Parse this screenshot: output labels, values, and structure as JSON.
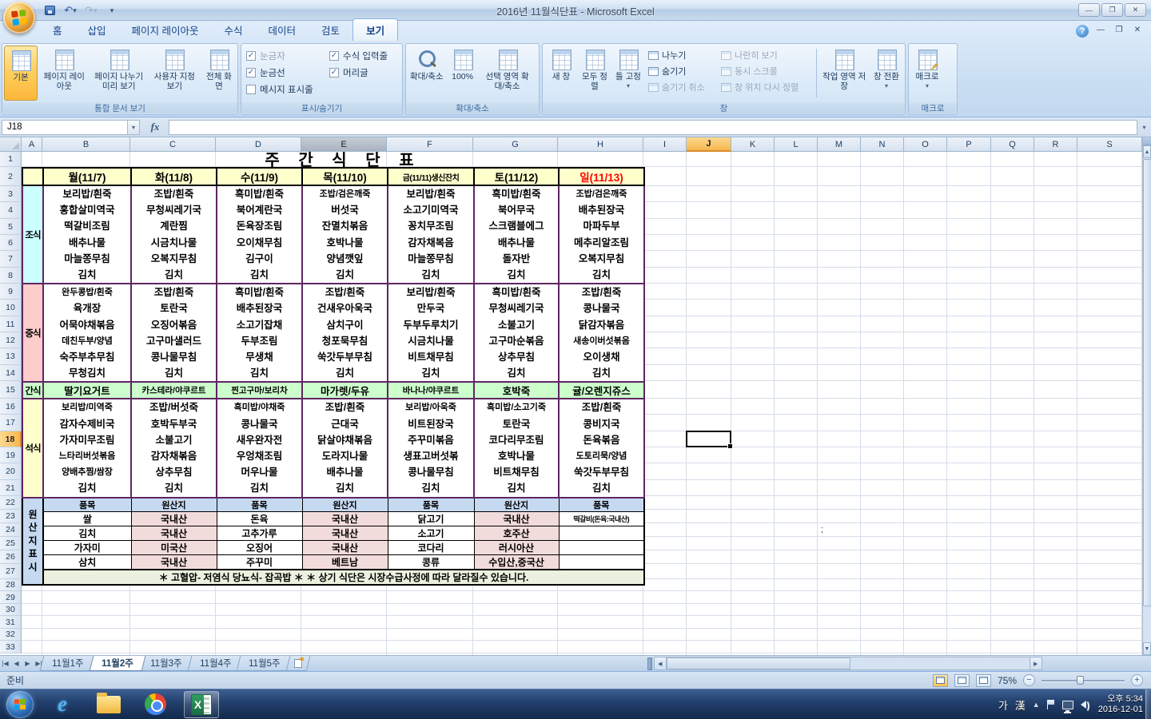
{
  "window": {
    "title": "2016년 11월식단표  -  Microsoft Excel",
    "controls": {
      "minimize": "—",
      "maximize": "❐",
      "close": "✕"
    }
  },
  "ribbon": {
    "tabs": [
      {
        "label": "홈"
      },
      {
        "label": "삽입"
      },
      {
        "label": "페이지 레이아웃"
      },
      {
        "label": "수식"
      },
      {
        "label": "데이터"
      },
      {
        "label": "검토"
      },
      {
        "label": "보기",
        "active": true
      }
    ],
    "doc_views": {
      "label": "통합 문서 보기",
      "buttons": [
        {
          "label": "기본",
          "icon": "normal-view",
          "active": true
        },
        {
          "label": "페이지 레이아웃",
          "icon": "page-layout"
        },
        {
          "label": "페이지 나누기 미리 보기",
          "icon": "page-break-preview"
        },
        {
          "label": "사용자 지정 보기",
          "icon": "custom-views"
        },
        {
          "label": "전체 화면",
          "icon": "full-screen"
        }
      ]
    },
    "show_hide": {
      "label": "표시/숨기기",
      "col1": [
        {
          "label": "눈금자",
          "checked": true,
          "disabled": true
        },
        {
          "label": "눈금선",
          "checked": true
        },
        {
          "label": "메시지 표시줄"
        }
      ],
      "col2": [
        {
          "label": "수식 입력줄",
          "checked": true
        },
        {
          "label": "머리글",
          "checked": true
        }
      ]
    },
    "zoom_group": {
      "label": "확대/축소",
      "buttons": [
        {
          "label": "확대/축소",
          "icon": "magnifier"
        },
        {
          "label": "100%",
          "icon": "zoom-100"
        },
        {
          "label": "선택 영역 확대/축소",
          "icon": "zoom-selection"
        }
      ]
    },
    "window_group": {
      "label": "창",
      "big": [
        {
          "label": "새 창",
          "icon": "new-window"
        },
        {
          "label": "모두 정렬",
          "icon": "arrange-all"
        },
        {
          "label": "틀 고정",
          "icon": "freeze-panes",
          "dropdown": true
        }
      ],
      "small1": [
        {
          "label": "나누기"
        },
        {
          "label": "숨기기"
        },
        {
          "label": "숨기기 취소",
          "disabled": true
        }
      ],
      "small2": [
        {
          "label": "나란히 보기",
          "disabled": true
        },
        {
          "label": "동시 스크롤",
          "disabled": true
        },
        {
          "label": "창 위치 다시 정렬",
          "disabled": true
        }
      ],
      "right": [
        {
          "label": "작업 영역 저장",
          "icon": "save-workspace"
        },
        {
          "label": "창 전환",
          "icon": "switch-windows",
          "dropdown": true
        }
      ]
    },
    "macro_group": {
      "label": "매크로",
      "buttons": [
        {
          "label": "매크로",
          "icon": "macro",
          "dropdown": true
        }
      ]
    },
    "help_label": "?"
  },
  "formula_bar": {
    "name_box": "J18",
    "fx_label": "fx",
    "value": ""
  },
  "grid": {
    "columns": [
      "A",
      "B",
      "C",
      "D",
      "E",
      "F",
      "G",
      "H",
      "I",
      "J",
      "K",
      "L",
      "M",
      "N",
      "O",
      "P",
      "Q",
      "R",
      "S"
    ],
    "row_count": 33,
    "selected_column": "J",
    "selected_row": 18,
    "shaded_column": "E",
    "stray_text": ";"
  },
  "sheet": {
    "title": "주 간 식 단 표",
    "day_headers": [
      {
        "label": "월(11/7)"
      },
      {
        "label": "화(11/8)"
      },
      {
        "label": "수(11/9)"
      },
      {
        "label": "목(11/10)"
      },
      {
        "label": "금(11/11)생신잔치",
        "small": true
      },
      {
        "label": "토(11/12)"
      },
      {
        "label": "일(11/13)",
        "sunday": true
      }
    ],
    "sections": [
      {
        "label": "조식",
        "bg": "#ccffff",
        "menus": [
          [
            "보리밥/흰죽",
            "홍합살미역국",
            "떡갈비조림",
            "배추나물",
            "마늘쫑무침",
            "김치"
          ],
          [
            "조밥/흰죽",
            "무청씨레기국",
            "계란찜",
            "시금치나물",
            "오복지무침",
            "김치"
          ],
          [
            "흑미밥/흰죽",
            "북어계란국",
            "돈육장조림",
            "오이채무침",
            "김구이",
            "김치"
          ],
          [
            "조밥/검은깨죽",
            "버섯국",
            "잔멸치볶음",
            "호박나물",
            "양념깻잎",
            "김치"
          ],
          [
            "보리밥/흰죽",
            "소고기미역국",
            "꽁치무조림",
            "감자채복음",
            "마늘쫑무침",
            "김치"
          ],
          [
            "흑미밥/흰죽",
            "북어무국",
            "스크램블에그",
            "배추나물",
            "돌자반",
            "김치"
          ],
          [
            "조밥/검은깨죽",
            "배추된장국",
            "마파두부",
            "메추리알조림",
            "오복지무침",
            "김치"
          ]
        ]
      },
      {
        "label": "중식",
        "bg": "#ffcccc",
        "menus": [
          [
            "완두콩밥/흰죽",
            "육개장",
            "어묵야채볶음",
            "데친두부/양념",
            "숙주부추무침",
            "무청김치"
          ],
          [
            "조밥/흰죽",
            "토란국",
            "오징어볶음",
            "고구마샐러드",
            "콩나물무침",
            "김치"
          ],
          [
            "흑미밥/흰죽",
            "배추된장국",
            "소고기잡채",
            "두부조림",
            "무생채",
            "김치"
          ],
          [
            "조밥/흰죽",
            "건새우아욱국",
            "삼치구이",
            "청포묵무침",
            "쑥갓두부무침",
            "김치"
          ],
          [
            "보리밥/흰죽",
            "만두국",
            "두부두루치기",
            "시금치나물",
            "비트채무침",
            "김치"
          ],
          [
            "흑미밥/흰죽",
            "무청씨레기국",
            "소불고기",
            "고구마순볶음",
            "상추무침",
            "김치"
          ],
          [
            "조밥/흰죽",
            "콩나물국",
            "닭감자볶음",
            "새송이버섯볶음",
            "오이생채",
            "김치"
          ]
        ]
      },
      {
        "label": "간식",
        "bg": "#ccffcc",
        "items": [
          "딸기요거트",
          "카스테라/야쿠르트",
          "찐고구마/보리차",
          "마가렛/두유",
          "바나나/야쿠르트",
          "호박죽",
          "귤/오렌지쥬스"
        ]
      },
      {
        "label": "석식",
        "bg": "#ffffcc",
        "menus": [
          [
            "보리밥/미역죽",
            "감자수제비국",
            "가자미무조림",
            "느타리버섯볶음",
            "양배추찜/쌈장",
            "김치"
          ],
          [
            "조밥/버섯죽",
            "호박두부국",
            "소불고기",
            "감자채볶음",
            "상추무침",
            "김치"
          ],
          [
            "흑미밥/야채죽",
            "콩나물국",
            "새우완자전",
            "우엉채조림",
            "머우나물",
            "김치"
          ],
          [
            "조밥/흰죽",
            "근대국",
            "닭살야채볶음",
            "도라지나물",
            "배추나물",
            "김치"
          ],
          [
            "보리밥/아욱죽",
            "비트된장국",
            "주꾸미볶음",
            "생표고버섯볶",
            "콩나물무침",
            "김치"
          ],
          [
            "흑미밥/소고기죽",
            "토란국",
            "코다리무조림",
            "호박나물",
            "비트채무침",
            "김치"
          ],
          [
            "조밥/흰죽",
            "콩비지국",
            "돈육볶음",
            "도토리묵/양념",
            "쑥갓두부무침",
            "김치"
          ]
        ]
      }
    ],
    "origin": {
      "label": "원산지표시",
      "headers": [
        "품목",
        "원산지",
        "품목",
        "원산지",
        "품목",
        "원산지",
        "품목"
      ],
      "rows": [
        [
          "쌀",
          "국내산",
          "돈육",
          "국내산",
          "닭고기",
          "국내산",
          "떡갈비(돈육:국내산)"
        ],
        [
          "김치",
          "국내산",
          "고추가루",
          "국내산",
          "소고기",
          "호주산",
          ""
        ],
        [
          "가자미",
          "미국산",
          "오징어",
          "국내산",
          "코다리",
          "러시아산",
          ""
        ],
        [
          "삼치",
          "국내산",
          "주꾸미",
          "베트남",
          "콩류",
          "수입산,중국산",
          ""
        ]
      ],
      "note": "＊ 고혈압- 저염식   당뇨식- 잡곡밥 ＊      ＊ 상기 식단은 시장수급사정에 따라 달라질수 있습니다."
    }
  },
  "tabs_bar": {
    "sheets": [
      {
        "label": "11월1주"
      },
      {
        "label": "11월2주",
        "active": true
      },
      {
        "label": "11월3주"
      },
      {
        "label": "11월4주"
      },
      {
        "label": "11월5주"
      }
    ]
  },
  "status_bar": {
    "ready": "준비",
    "zoom": "75%"
  },
  "taskbar": {
    "ime_ko": "가",
    "ime_hanja": "漢",
    "time": "오후 5:34",
    "date": "2016-12-01"
  },
  "colors": {
    "accent_selection": "#f7b84f",
    "table_border": "#5e2663",
    "day_header_bg": "#ffffcc",
    "sunday_text": "#ff0000",
    "origin_header_bg": "#c5d9f1",
    "origin_value_bg": "#f2dcdb",
    "note_bg": "#ebf1de"
  }
}
